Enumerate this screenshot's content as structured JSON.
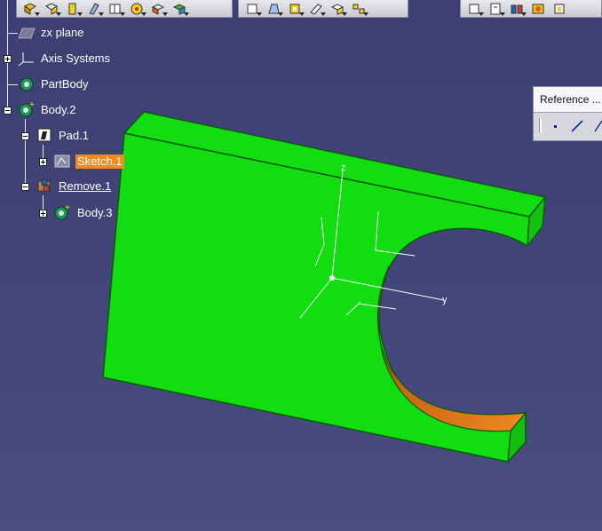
{
  "tree": {
    "items": [
      {
        "label": "zx plane",
        "icon": "plane-icon"
      },
      {
        "label": "Axis Systems",
        "icon": "axis-system-icon"
      },
      {
        "label": "PartBody",
        "icon": "partbody-icon"
      },
      {
        "label": "Body.2",
        "icon": "body-icon"
      },
      {
        "label": "Pad.1",
        "icon": "pad-icon"
      },
      {
        "label": "Sketch.1",
        "icon": "sketch-icon",
        "selected": true
      },
      {
        "label": "Remove.1",
        "icon": "remove-icon"
      },
      {
        "label": "Body.3",
        "icon": "body-icon"
      }
    ]
  },
  "reference_toolbar": {
    "title": "Reference ...",
    "buttons": [
      "point-icon",
      "line-icon",
      "plane-icon"
    ]
  },
  "axis_labels": {
    "z": "z",
    "y": "y"
  },
  "colors": {
    "part_face": "#11dd10",
    "part_edge": "#0d6a0a",
    "cut_surface": "#e07412",
    "selection": "#f28a1c"
  }
}
